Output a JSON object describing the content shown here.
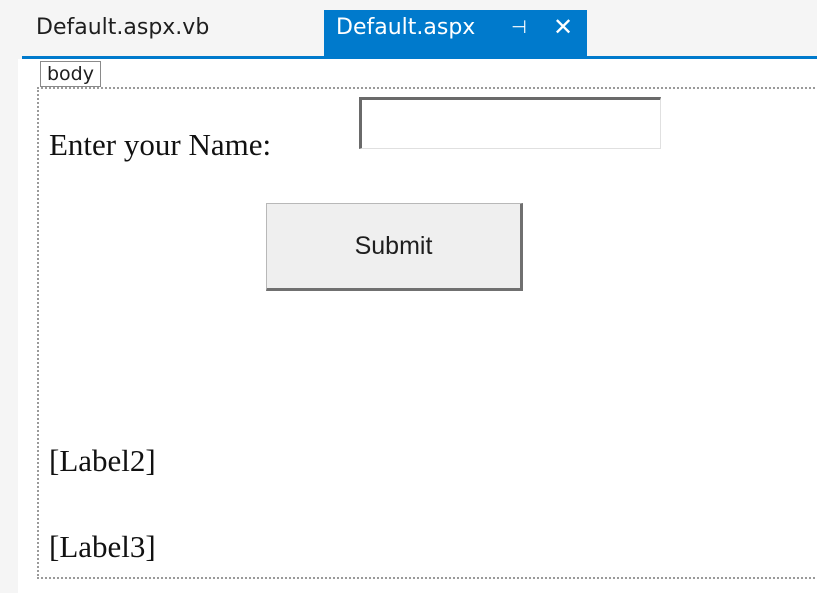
{
  "tabs": [
    {
      "label": "Default.aspx.vb",
      "active": false
    },
    {
      "label": "Default.aspx",
      "active": true,
      "pin_icon": "pin-icon",
      "close_icon": "close-icon"
    }
  ],
  "icons": {
    "pin": "⊣",
    "close": "✕"
  },
  "colors": {
    "active_tab": "#007acc",
    "editor_background": "#ffffff"
  },
  "editor": {
    "element_tag": "body",
    "form": {
      "name_label": "Enter your Name:",
      "name_input_value": "",
      "submit_label": "Submit",
      "label2": "[Label2]",
      "label3": "[Label3]"
    }
  }
}
